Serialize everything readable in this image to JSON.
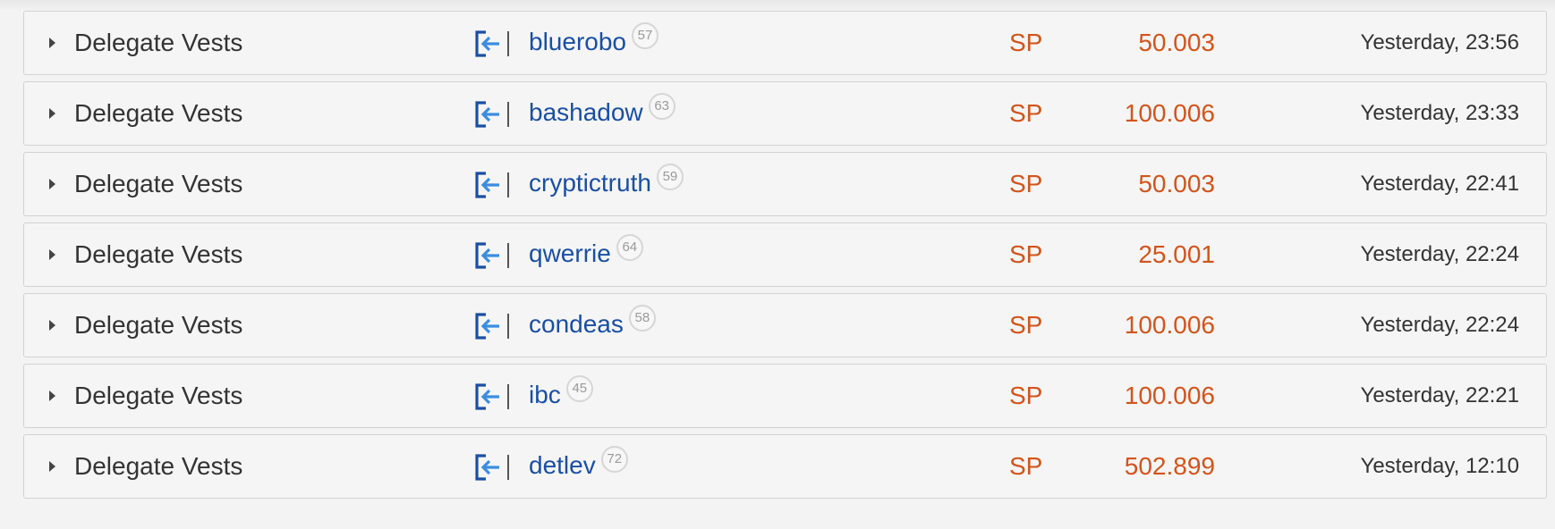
{
  "colors": {
    "account_link": "#1a4fa3",
    "amount": "#d3541b",
    "icon_bracket": "#1a4fa3",
    "icon_arrow": "#3b8de0"
  },
  "rows": [
    {
      "operation": "Delegate Vests",
      "icon": "incoming-delegation-icon",
      "account": "bluerobo",
      "reputation": "57",
      "currency": "SP",
      "amount": "50.003",
      "time": "Yesterday, 23:56"
    },
    {
      "operation": "Delegate Vests",
      "icon": "incoming-delegation-icon",
      "account": "bashadow",
      "reputation": "63",
      "currency": "SP",
      "amount": "100.006",
      "time": "Yesterday, 23:33"
    },
    {
      "operation": "Delegate Vests",
      "icon": "incoming-delegation-icon",
      "account": "cryptictruth",
      "reputation": "59",
      "currency": "SP",
      "amount": "50.003",
      "time": "Yesterday, 22:41"
    },
    {
      "operation": "Delegate Vests",
      "icon": "incoming-delegation-icon",
      "account": "qwerrie",
      "reputation": "64",
      "currency": "SP",
      "amount": "25.001",
      "time": "Yesterday, 22:24"
    },
    {
      "operation": "Delegate Vests",
      "icon": "incoming-delegation-icon",
      "account": "condeas",
      "reputation": "58",
      "currency": "SP",
      "amount": "100.006",
      "time": "Yesterday, 22:24"
    },
    {
      "operation": "Delegate Vests",
      "icon": "incoming-delegation-icon",
      "account": "ibc",
      "reputation": "45",
      "currency": "SP",
      "amount": "100.006",
      "time": "Yesterday, 22:21"
    },
    {
      "operation": "Delegate Vests",
      "icon": "incoming-delegation-icon",
      "account": "detlev",
      "reputation": "72",
      "currency": "SP",
      "amount": "502.899",
      "time": "Yesterday, 12:10"
    }
  ]
}
